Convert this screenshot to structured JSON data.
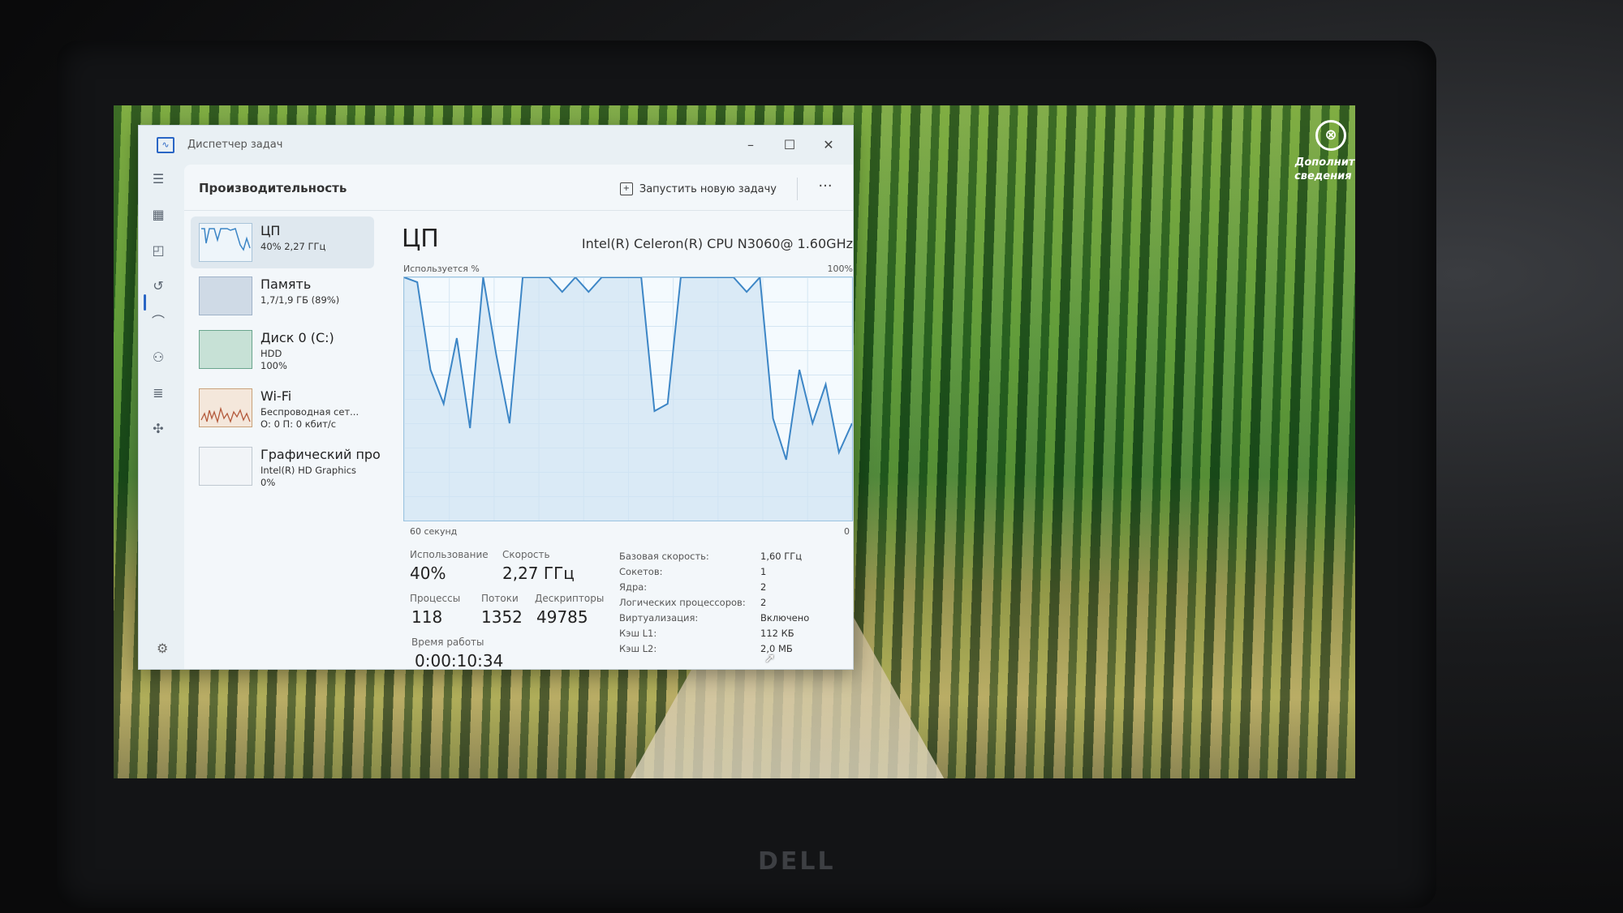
{
  "window": {
    "title": "Диспетчер задач",
    "minimize": "–",
    "maximize": "☐",
    "close": "✕"
  },
  "header": {
    "title": "Производительность",
    "run_new_task": "Запустить новую задачу",
    "more": "···"
  },
  "desktop": {
    "icon_label_line1": "Дополнит...",
    "icon_label_line2": "сведения ...",
    "brand": "DELL"
  },
  "sidebar": {
    "items": [
      {
        "name": "ЦП",
        "sub1": "40% 2,27 ГГц",
        "sub2": "",
        "sub3": ""
      },
      {
        "name": "Память",
        "sub1": "1,7/1,9 ГБ (89%)",
        "sub2": "",
        "sub3": ""
      },
      {
        "name": "Диск 0 (C:)",
        "sub1": "HDD",
        "sub2": "100%",
        "sub3": ""
      },
      {
        "name": "Wi-Fi",
        "sub1": "Беспроводная сет...",
        "sub2": "О: 0 П: 0 кбит/с",
        "sub3": ""
      },
      {
        "name": "Графический про",
        "sub1": "Intel(R) HD Graphics",
        "sub2": "0%",
        "sub3": ""
      }
    ]
  },
  "cpu": {
    "title": "ЦП",
    "model": "Intel(R) Celeron(R) CPU N3060@ 1.60GHz",
    "util_label": "Используется %",
    "max_label": "100%",
    "span_label": "60 секунд",
    "zero_label": "0",
    "stats": {
      "usage_label": "Использование",
      "usage": "40%",
      "speed_label": "Скорость",
      "speed": "2,27 ГГц",
      "processes_label": "Процессы",
      "processes": "118",
      "threads_label": "Потоки",
      "threads": "1352",
      "handles_label": "Дескрипторы",
      "handles": "49785",
      "uptime_label": "Время работы",
      "uptime": "0:00:10:34"
    },
    "details": [
      {
        "key": "Базовая скорость:",
        "value": "1,60 ГГц"
      },
      {
        "key": "Сокетов:",
        "value": "1"
      },
      {
        "key": "Ядра:",
        "value": "2"
      },
      {
        "key": "Логических процессоров:",
        "value": "2"
      },
      {
        "key": "Виртуализация:",
        "value": "Включено"
      },
      {
        "key": "Кэш L1:",
        "value": "112 КБ"
      },
      {
        "key": "Кэш L2:",
        "value": "2,0 МБ"
      }
    ]
  },
  "chart_data": {
    "type": "area",
    "title": "",
    "xlabel": "60 секунд",
    "ylabel": "Используется %",
    "ylim": [
      0,
      100
    ],
    "x": [
      60,
      58,
      56,
      54,
      52,
      50,
      48,
      46,
      44,
      42,
      40,
      38,
      36,
      34,
      32,
      30,
      28,
      26,
      24,
      22,
      20,
      18,
      16,
      14,
      12,
      10,
      8,
      6,
      4,
      2,
      0
    ],
    "series": [
      {
        "values": [
          100,
          98,
          62,
          48,
          75,
          38,
          100,
          68,
          40,
          100,
          100,
          100,
          94,
          100,
          94,
          100,
          100,
          100,
          100,
          45,
          48,
          100,
          100,
          100,
          100,
          100,
          94,
          100,
          42,
          25,
          62,
          40,
          56,
          28,
          40
        ]
      }
    ],
    "colors": {
      "line": "#3d86c6",
      "fill": "#cfe3f2"
    }
  }
}
